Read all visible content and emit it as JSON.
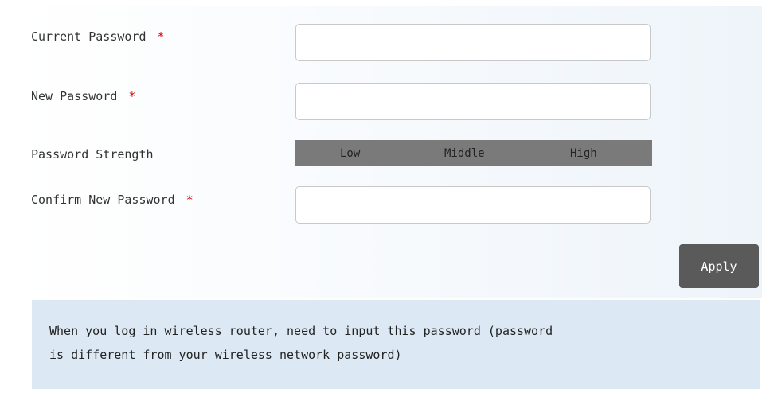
{
  "form": {
    "current_password": {
      "label": "Current Password",
      "required_mark": "*",
      "value": "",
      "type": "password"
    },
    "new_password": {
      "label": "New Password",
      "required_mark": "*",
      "value": "",
      "type": "password"
    },
    "password_strength": {
      "label": "Password Strength",
      "levels": [
        "Low",
        "Middle",
        "High"
      ],
      "bar_color": "#7a7a7a"
    },
    "confirm_password": {
      "label": "Confirm New Password",
      "required_mark": "*",
      "value": "",
      "type": "password"
    },
    "apply_label": "Apply"
  },
  "notice": {
    "text": "When you log in wireless router, need to input this password (password\nis different from your wireless network password)"
  },
  "colors": {
    "required": "#d40000",
    "apply_button": "#5a5a5a",
    "notice_background": "#dce9f4"
  }
}
